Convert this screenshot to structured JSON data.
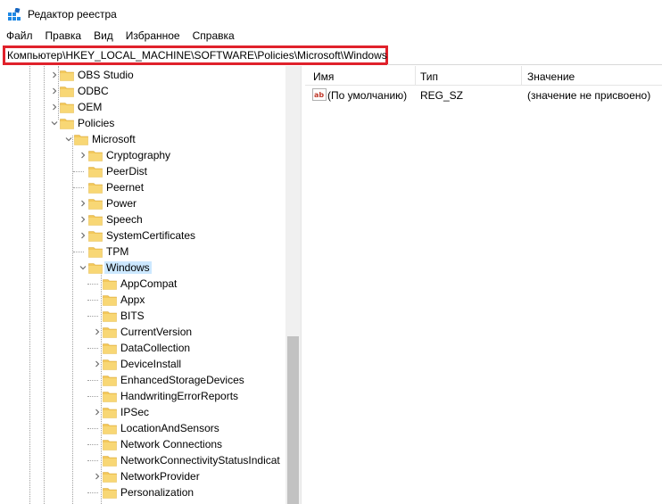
{
  "window": {
    "title": "Редактор реестра"
  },
  "menu": [
    "Файл",
    "Правка",
    "Вид",
    "Избранное",
    "Справка"
  ],
  "address": {
    "path": "Компьютер\\HKEY_LOCAL_MACHINE\\SOFTWARE\\Policies\\Microsoft\\Windows"
  },
  "tree": {
    "items": [
      {
        "label": "OBS Studio",
        "expandable": true
      },
      {
        "label": "ODBC",
        "expandable": true
      },
      {
        "label": "OEM",
        "expandable": true
      },
      {
        "label": "Policies",
        "expandable": true,
        "expanded": true
      },
      {
        "label": "Microsoft",
        "expandable": true,
        "expanded": true
      },
      {
        "label": "Cryptography",
        "expandable": true
      },
      {
        "label": "PeerDist",
        "expandable": false
      },
      {
        "label": "Peernet",
        "expandable": false
      },
      {
        "label": "Power",
        "expandable": true
      },
      {
        "label": "Speech",
        "expandable": true
      },
      {
        "label": "SystemCertificates",
        "expandable": true
      },
      {
        "label": "TPM",
        "expandable": false
      },
      {
        "label": "Windows",
        "expandable": true,
        "expanded": true,
        "selected": true
      },
      {
        "label": "AppCompat",
        "expandable": false
      },
      {
        "label": "Appx",
        "expandable": false
      },
      {
        "label": "BITS",
        "expandable": false
      },
      {
        "label": "CurrentVersion",
        "expandable": true
      },
      {
        "label": "DataCollection",
        "expandable": false
      },
      {
        "label": "DeviceInstall",
        "expandable": true
      },
      {
        "label": "EnhancedStorageDevices",
        "expandable": false
      },
      {
        "label": "HandwritingErrorReports",
        "expandable": false
      },
      {
        "label": "IPSec",
        "expandable": true
      },
      {
        "label": "LocationAndSensors",
        "expandable": false
      },
      {
        "label": "Network Connections",
        "expandable": false
      },
      {
        "label": "NetworkConnectivityStatusIndicat",
        "expandable": false
      },
      {
        "label": "NetworkProvider",
        "expandable": true
      },
      {
        "label": "Personalization",
        "expandable": false
      }
    ]
  },
  "list": {
    "columns": [
      "Имя",
      "Тип",
      "Значение"
    ],
    "rows": [
      {
        "name": "(По умолчанию)",
        "type": "REG_SZ",
        "value": "(значение не присвоено)",
        "icon": "reg-string-icon"
      }
    ]
  },
  "colors": {
    "selection": "#cce8ff",
    "highlight_border": "#e0212b",
    "folder": "#f8d775",
    "scroll_thumb": "#c2c2c2"
  }
}
